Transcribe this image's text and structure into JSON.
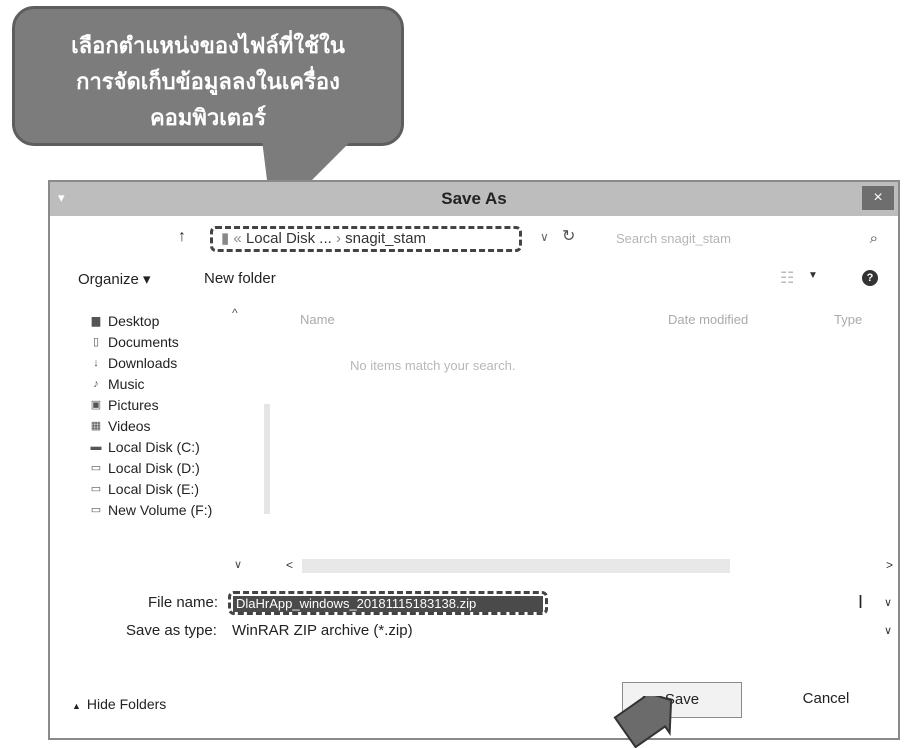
{
  "callout": {
    "lines": [
      "เลือกตำแหน่งของไฟล์ที่ใช้ใน",
      "การจัดเก็บข้อมูลลงในเครื่อง",
      "คอมพิวเตอร์"
    ]
  },
  "dialog": {
    "title": "Save As",
    "close_glyph": "×",
    "address": {
      "prefix": "« ",
      "segment1": "Local Disk ...",
      "separator": " › ",
      "segment2": "snagit_stam"
    },
    "search_placeholder": "Search snagit_stam",
    "toolbar": {
      "organize": "Organize ▾",
      "new_folder": "New folder"
    },
    "sidebar": [
      {
        "label": "Desktop",
        "icon": "desktop-icon",
        "glyph": "▆"
      },
      {
        "label": "Documents",
        "icon": "documents-icon",
        "glyph": "▯"
      },
      {
        "label": "Downloads",
        "icon": "downloads-icon",
        "glyph": "↓"
      },
      {
        "label": "Music",
        "icon": "music-icon",
        "glyph": "♪"
      },
      {
        "label": "Pictures",
        "icon": "pictures-icon",
        "glyph": "▣"
      },
      {
        "label": "Videos",
        "icon": "videos-icon",
        "glyph": "▦"
      },
      {
        "label": "Local Disk (C:)",
        "icon": "drive-icon",
        "glyph": "▬"
      },
      {
        "label": "Local Disk (D:)",
        "icon": "drive-icon",
        "glyph": "▭"
      },
      {
        "label": "Local Disk (E:)",
        "icon": "drive-icon",
        "glyph": "▭"
      },
      {
        "label": "New Volume (F:)",
        "icon": "drive-icon",
        "glyph": "▭"
      }
    ],
    "columns": {
      "name": "Name",
      "date": "Date modified",
      "type": "Type"
    },
    "empty_message": "No items match your search.",
    "file_name_label": "File name:",
    "file_name_value": "DlaHrApp_windows_20181115183138.zip",
    "save_type_label": "Save as type:",
    "save_type_value": "WinRAR ZIP archive (*.zip)",
    "hide_folders": "Hide Folders",
    "save_button": "Save",
    "cancel_button": "Cancel"
  }
}
